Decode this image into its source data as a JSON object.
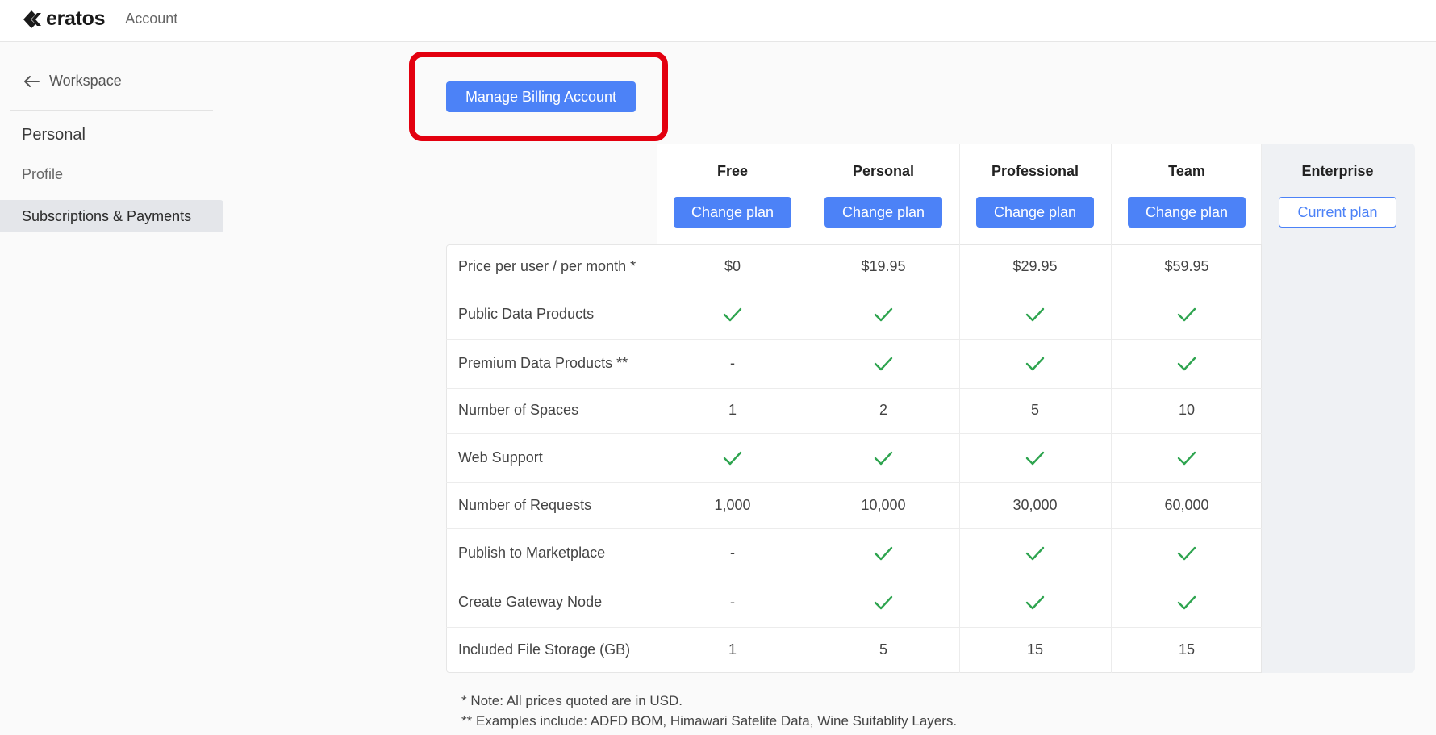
{
  "header": {
    "brand": "eratos",
    "section": "Account",
    "logo_icon": "eratos-logo-icon"
  },
  "sidebar": {
    "back_label": "Workspace",
    "back_icon": "arrow-left-icon",
    "heading": "Personal",
    "items": [
      {
        "label": "Profile",
        "active": false
      },
      {
        "label": "Subscriptions & Payments",
        "active": true
      }
    ]
  },
  "billing": {
    "manage_button": "Manage Billing Account",
    "highlight_color": "#e3000f"
  },
  "plans": [
    {
      "name": "Free",
      "action": "Change plan",
      "current": false
    },
    {
      "name": "Personal",
      "action": "Change plan",
      "current": false
    },
    {
      "name": "Professional",
      "action": "Change plan",
      "current": false
    },
    {
      "name": "Team",
      "action": "Change plan",
      "current": false
    },
    {
      "name": "Enterprise",
      "action": "Current plan",
      "current": true
    }
  ],
  "features": [
    {
      "label": "Price per user / per month *",
      "values": [
        "$0",
        "$19.95",
        "$29.95",
        "$59.95"
      ]
    },
    {
      "label": "Public Data Products",
      "values": [
        "check",
        "check",
        "check",
        "check"
      ]
    },
    {
      "label": "Premium Data Products **",
      "values": [
        "-",
        "check",
        "check",
        "check"
      ]
    },
    {
      "label": "Number of Spaces",
      "values": [
        "1",
        "2",
        "5",
        "10"
      ]
    },
    {
      "label": "Web Support",
      "values": [
        "check",
        "check",
        "check",
        "check"
      ]
    },
    {
      "label": "Number of Requests",
      "values": [
        "1,000",
        "10,000",
        "30,000",
        "60,000"
      ]
    },
    {
      "label": "Publish to Marketplace",
      "values": [
        "-",
        "check",
        "check",
        "check"
      ]
    },
    {
      "label": "Create Gateway Node",
      "values": [
        "-",
        "check",
        "check",
        "check"
      ]
    },
    {
      "label": "Included File Storage (GB)",
      "values": [
        "1",
        "5",
        "15",
        "15"
      ]
    }
  ],
  "notes": [
    "* Note: All prices quoted are in USD.",
    "** Examples include: ADFD BOM, Himawari Satelite Data, Wine Suitablity Layers."
  ],
  "colors": {
    "accent": "#4c82f7",
    "check": "#2ea44f"
  }
}
